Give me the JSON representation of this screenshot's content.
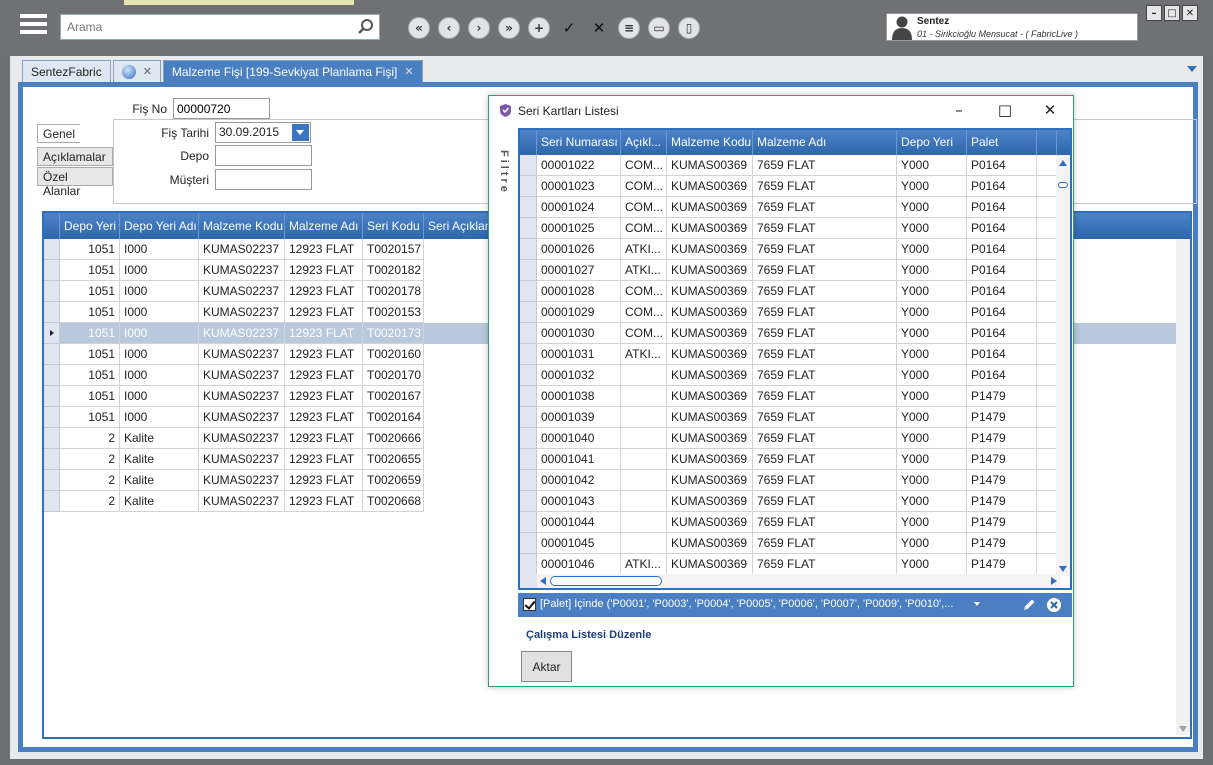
{
  "search": {
    "placeholder": "Arama"
  },
  "user": {
    "name": "Sentez",
    "company": "01 - Sirikcioğlu Mensucat - ( FabricLive )"
  },
  "tabs": [
    {
      "label": "SentezFabric"
    },
    {
      "label": ""
    },
    {
      "label": "Malzeme Fişi  [199-Sevkiyat Planlama Fişi]"
    }
  ],
  "form": {
    "fis_no_label": "Fiş No",
    "fis_no_value": "00000720",
    "fis_tarihi_label": "Fiş Tarihi",
    "fis_tarihi_value": "30.09.2015",
    "depo_label": "Depo",
    "depo_value": "",
    "musteri_label": "Müşteri",
    "musteri_value": ""
  },
  "side_tabs": [
    "Genel",
    "Açıklamalar",
    "Özel Alanlar"
  ],
  "main_grid": {
    "columns": [
      "Depo Yeri",
      "Depo Yeri Adı",
      "Malzeme Kodu",
      "Malzeme Adı",
      "Seri Kodu",
      "Seri Açıklama"
    ],
    "rows": [
      [
        "1051",
        "I000",
        "KUMAS02237",
        "12923 FLAT",
        "T0020157"
      ],
      [
        "1051",
        "I000",
        "KUMAS02237",
        "12923 FLAT",
        "T0020182"
      ],
      [
        "1051",
        "I000",
        "KUMAS02237",
        "12923 FLAT",
        "T0020178"
      ],
      [
        "1051",
        "I000",
        "KUMAS02237",
        "12923 FLAT",
        "T0020153"
      ],
      [
        "1051",
        "I000",
        "KUMAS02237",
        "12923 FLAT",
        "T0020173"
      ],
      [
        "1051",
        "I000",
        "KUMAS02237",
        "12923 FLAT",
        "T0020160"
      ],
      [
        "1051",
        "I000",
        "KUMAS02237",
        "12923 FLAT",
        "T0020170"
      ],
      [
        "1051",
        "I000",
        "KUMAS02237",
        "12923 FLAT",
        "T0020167"
      ],
      [
        "1051",
        "I000",
        "KUMAS02237",
        "12923 FLAT",
        "T0020164"
      ],
      [
        "2",
        "Kalite",
        "KUMAS02237",
        "12923 FLAT",
        "T0020666"
      ],
      [
        "2",
        "Kalite",
        "KUMAS02237",
        "12923 FLAT",
        "T0020655"
      ],
      [
        "2",
        "Kalite",
        "KUMAS02237",
        "12923 FLAT",
        "T0020659"
      ],
      [
        "2",
        "Kalite",
        "KUMAS02237",
        "12923 FLAT",
        "T0020668"
      ]
    ],
    "selected_row": 4
  },
  "dialog": {
    "title": "Seri Kartları Listesi",
    "filtre_label": "Filtre",
    "columns": [
      "Seri Numarası",
      "Açıkl...",
      "Malzeme Kodu",
      "Malzeme Adı",
      "Depo Yeri",
      "Palet"
    ],
    "rows": [
      [
        "00001022",
        "COM...",
        "KUMAS00369",
        "7659 FLAT",
        "Y000",
        "P0164"
      ],
      [
        "00001023",
        "COM...",
        "KUMAS00369",
        "7659 FLAT",
        "Y000",
        "P0164"
      ],
      [
        "00001024",
        "COM...",
        "KUMAS00369",
        "7659 FLAT",
        "Y000",
        "P0164"
      ],
      [
        "00001025",
        "COM...",
        "KUMAS00369",
        "7659 FLAT",
        "Y000",
        "P0164"
      ],
      [
        "00001026",
        "ATKI...",
        "KUMAS00369",
        "7659 FLAT",
        "Y000",
        "P0164"
      ],
      [
        "00001027",
        "ATKI...",
        "KUMAS00369",
        "7659 FLAT",
        "Y000",
        "P0164"
      ],
      [
        "00001028",
        "COM...",
        "KUMAS00369",
        "7659 FLAT",
        "Y000",
        "P0164"
      ],
      [
        "00001029",
        "COM...",
        "KUMAS00369",
        "7659 FLAT",
        "Y000",
        "P0164"
      ],
      [
        "00001030",
        "COM...",
        "KUMAS00369",
        "7659 FLAT",
        "Y000",
        "P0164"
      ],
      [
        "00001031",
        "ATKI...",
        "KUMAS00369",
        "7659 FLAT",
        "Y000",
        "P0164"
      ],
      [
        "00001032",
        "",
        "KUMAS00369",
        "7659 FLAT",
        "Y000",
        "P0164"
      ],
      [
        "00001038",
        "",
        "KUMAS00369",
        "7659 FLAT",
        "Y000",
        "P1479"
      ],
      [
        "00001039",
        "",
        "KUMAS00369",
        "7659 FLAT",
        "Y000",
        "P1479"
      ],
      [
        "00001040",
        "",
        "KUMAS00369",
        "7659 FLAT",
        "Y000",
        "P1479"
      ],
      [
        "00001041",
        "",
        "KUMAS00369",
        "7659 FLAT",
        "Y000",
        "P1479"
      ],
      [
        "00001042",
        "",
        "KUMAS00369",
        "7659 FLAT",
        "Y000",
        "P1479"
      ],
      [
        "00001043",
        "",
        "KUMAS00369",
        "7659 FLAT",
        "Y000",
        "P1479"
      ],
      [
        "00001044",
        "",
        "KUMAS00369",
        "7659 FLAT",
        "Y000",
        "P1479"
      ],
      [
        "00001045",
        "",
        "KUMAS00369",
        "7659 FLAT",
        "Y000",
        "P1479"
      ],
      [
        "00001046",
        "ATKI...",
        "KUMAS00369",
        "7659 FLAT",
        "Y000",
        "P1479"
      ]
    ],
    "filter_text": "[Palet] İçinde ('P0001', 'P0003', 'P0004', 'P0005', 'P0006', 'P0007', 'P0009', 'P0010',...",
    "calisma_link": "Çalışma Listesi Düzenle",
    "aktar_label": "Aktar"
  },
  "colors": {
    "accent": "#4a7fc1",
    "header_dark": "#2e66ad",
    "selected_row": "#b9c8dd",
    "dialog_border": "#2f9c7c"
  },
  "icons": [
    "hamburger-icon",
    "search-icon",
    "first-icon",
    "prev-icon",
    "next-icon",
    "last-icon",
    "add-icon",
    "check-icon",
    "close-icon",
    "menu-icon",
    "keyboard-icon",
    "trash-icon",
    "user-icon",
    "globe-icon",
    "shield-icon",
    "pencil-icon",
    "clear-filter-icon"
  ]
}
